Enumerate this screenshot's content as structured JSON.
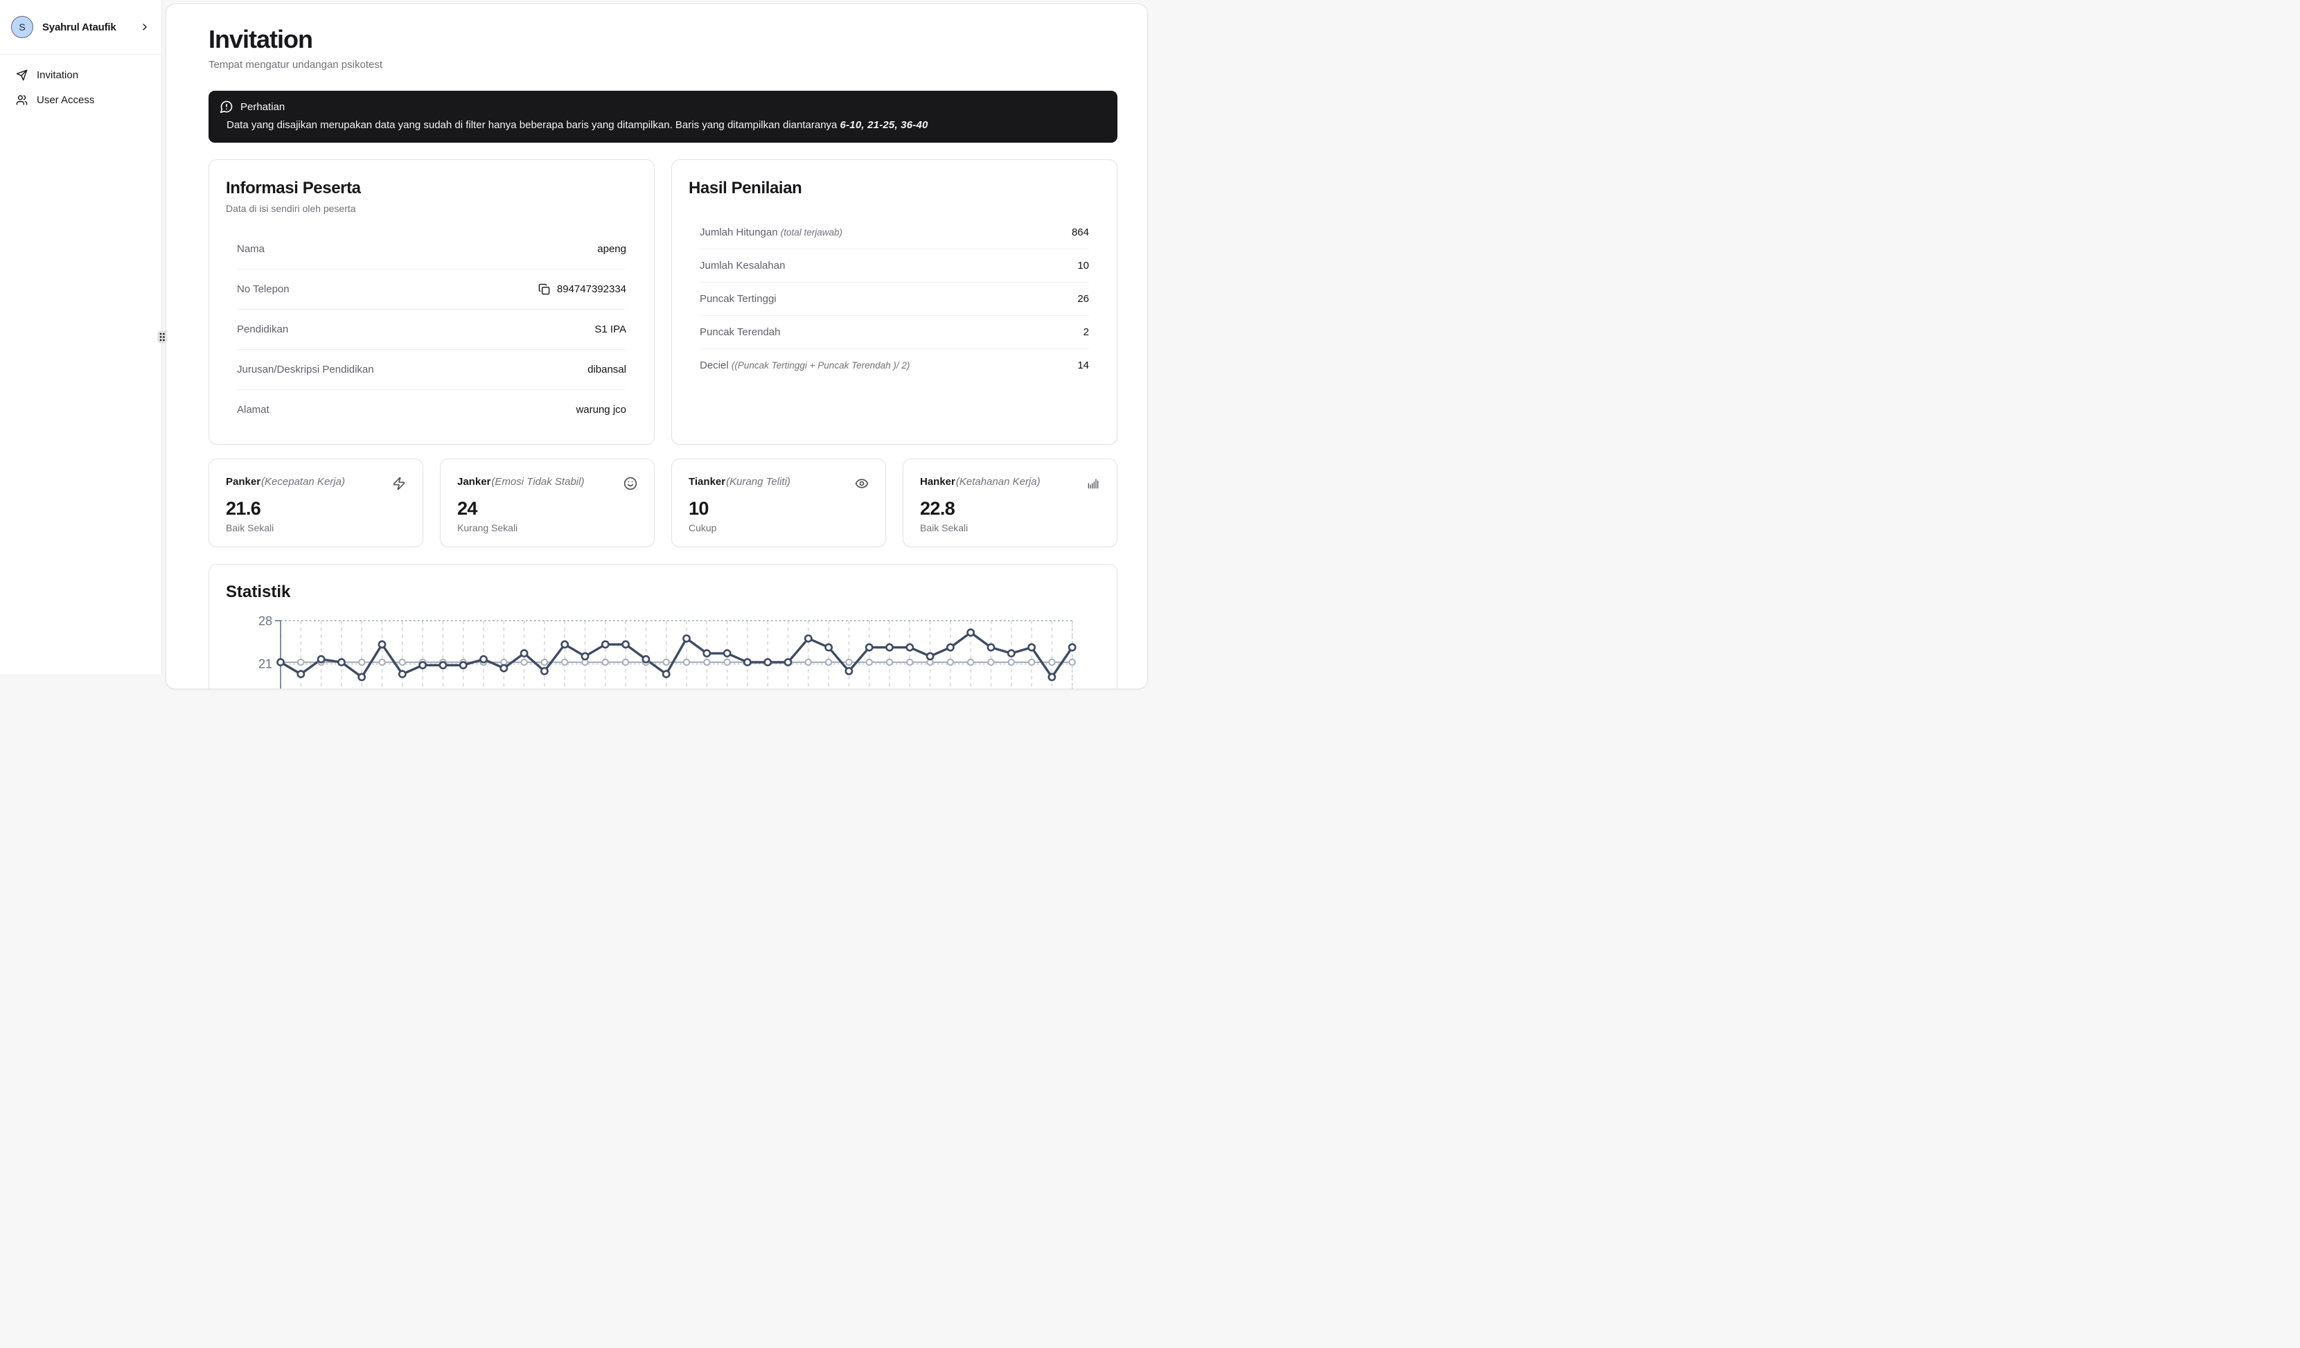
{
  "sidebar": {
    "user": {
      "initial": "S",
      "name": "Syahrul Ataufik"
    },
    "items": [
      {
        "label": "Invitation",
        "icon": "send-icon"
      },
      {
        "label": "User Access",
        "icon": "users-icon"
      }
    ]
  },
  "header": {
    "title": "Invitation",
    "subtitle": "Tempat mengatur undangan psikotest"
  },
  "alert": {
    "icon": "message-warning-icon",
    "title": "Perhatian",
    "body": "Data yang disajikan merupakan data yang sudah di filter hanya beberapa baris yang ditampilkan. Baris yang ditampilkan diantaranya ",
    "highlight": "6-10, 21-25, 36-40"
  },
  "participant_card": {
    "title": "Informasi Peserta",
    "subtitle": "Data di isi sendiri oleh peserta",
    "rows": [
      {
        "label": "Nama",
        "value": "apeng"
      },
      {
        "label": "No Telepon",
        "value": "894747392334",
        "copy": true
      },
      {
        "label": "Pendidikan",
        "value": "S1 IPA"
      },
      {
        "label": "Jurusan/Deskripsi Pendidikan",
        "value": "dibansal"
      },
      {
        "label": "Alamat",
        "value": "warung jco"
      }
    ]
  },
  "result_card": {
    "title": "Hasil Penilaian",
    "rows": [
      {
        "label": "Jumlah Hitungan",
        "note": "(total terjawab)",
        "value": "864"
      },
      {
        "label": "Jumlah Kesalahan",
        "note": "",
        "value": "10"
      },
      {
        "label": "Puncak Tertinggi",
        "note": "",
        "value": "26"
      },
      {
        "label": "Puncak Terendah",
        "note": "",
        "value": "2"
      },
      {
        "label": "Deciel",
        "note": "((Puncak Tertinggi + Puncak Terendah )/ 2)",
        "value": "14"
      }
    ]
  },
  "stat_cards": [
    {
      "name": "Panker",
      "note": "(Kecepatan Kerja)",
      "icon": "zap-icon",
      "value": "21.6",
      "rating": "Baik Sekali"
    },
    {
      "name": "Janker",
      "note": "(Emosi Tidak Stabil)",
      "icon": "smile-icon",
      "value": "24",
      "rating": "Kurang Sekali"
    },
    {
      "name": "Tianker",
      "note": "(Kurang Teliti)",
      "icon": "eye-icon",
      "value": "10",
      "rating": "Cukup"
    },
    {
      "name": "Hanker",
      "note": "(Ketahanan Kerja)",
      "icon": "bar-chart-icon",
      "value": "22.8",
      "rating": "Baik Sekali"
    }
  ],
  "statistics_card": {
    "title": "Statistik"
  },
  "chart_data": {
    "type": "line",
    "title": "Statistik",
    "points": 40,
    "visible_yticks": [
      28,
      21
    ],
    "ylim_visible_top": 28,
    "grid": "dashed vertical line per point, dotted horizontal lines at 28 and 21, chart bottom cropped by viewport",
    "legend": false,
    "series": [
      {
        "name": "hasil-per-kolom",
        "color": "#3f4b63",
        "values": [
          21,
          19,
          21.5,
          21,
          18.5,
          24,
          19,
          20.5,
          20.5,
          20.5,
          21.5,
          20,
          22.5,
          19.5,
          24,
          22,
          24,
          24,
          21.5,
          19,
          25,
          22.5,
          22.5,
          21,
          21,
          21,
          25,
          23.5,
          19.5,
          23.5,
          23.5,
          23.5,
          22,
          23.5,
          26,
          23.5,
          22.5,
          23.5,
          18.5,
          23.5
        ]
      },
      {
        "name": "garis-standar",
        "color": "#a6adbb",
        "values": [
          21,
          21,
          21,
          21,
          21,
          21,
          21,
          21,
          21,
          21,
          21,
          21,
          21,
          21,
          21,
          21,
          21,
          21,
          21,
          21,
          21,
          21,
          21,
          21,
          21,
          21,
          21,
          21,
          21,
          21,
          21,
          21,
          21,
          21,
          21,
          21,
          21,
          21,
          21,
          21
        ]
      }
    ]
  },
  "colors": {
    "page_bg": "#f7f7f8",
    "panel_bg": "#ffffff",
    "alert_bg": "#18181b",
    "text_primary": "#18181b",
    "text_muted": "#71717a",
    "border": "#e4e4e7",
    "avatar_bg": "#bcd7f8",
    "chart_line": "#3f4b63",
    "chart_reference": "#a6adbb",
    "chart_grid": "#d4d4d8"
  }
}
